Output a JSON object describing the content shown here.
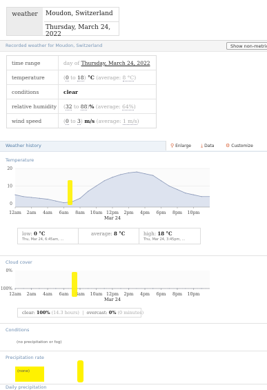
{
  "query": {
    "key": "weather",
    "location": "Moudon, Switzerland",
    "date": "Thursday, March 24, 2022"
  },
  "recorded": {
    "title": "Recorded weather for Moudon, Switzerland",
    "metric_button": "Show non-metric"
  },
  "table": {
    "rows": [
      {
        "label": "time range",
        "prefix": "day of ",
        "value": "Thursday, March 24, 2022"
      },
      {
        "label": "temperature",
        "range_open": "(",
        "low": "0",
        "to": " to ",
        "high": "18",
        "range_close": ")",
        "unit": " °C",
        "avg_open": " (average: ",
        "avg": "8 °C",
        "avg_close": ")"
      },
      {
        "label": "conditions",
        "value": "clear"
      },
      {
        "label": "relative humidity",
        "range_open": "(",
        "low": "32",
        "to": " to ",
        "high": "88",
        "range_close": ")",
        "unit": "%",
        "avg_open": " (average: ",
        "avg": "64%",
        "avg_close": ")"
      },
      {
        "label": "wind speed",
        "range_open": "(",
        "low": "0",
        "to": " to ",
        "high": "3",
        "range_close": ")",
        "unit": " m/s",
        "avg_open": " (average: ",
        "avg": "1 m/s",
        "avg_close": ")"
      }
    ]
  },
  "history": {
    "title": "Weather history",
    "tools": [
      "Enlarge",
      "Data",
      "Customize"
    ],
    "icons": [
      "magnifier-icon",
      "download-icon",
      "customize-icon"
    ]
  },
  "temperature": {
    "subtitle": "Temperature",
    "stats": {
      "low_label": "low: ",
      "low_value": "0 °C",
      "low_time": "Thu, Mar 24, 6:45am, ...",
      "avg_label": "average: ",
      "avg_value": "8 °C",
      "high_label": "high: ",
      "high_value": "18 °C",
      "high_time": "Thu, Mar 24, 3:45pm, ..."
    }
  },
  "cloud": {
    "subtitle": "Cloud cover",
    "stats": {
      "clear_label": "clear: ",
      "clear_value": "100%",
      "clear_dur": " (14.3 hours)",
      "sep": "  |  ",
      "overcast_label": "overcast: ",
      "overcast_value": "0%",
      "overcast_dur": " (0 minutes)"
    }
  },
  "conditions": {
    "subtitle": "Conditions",
    "note": "(no precipitation or fog)"
  },
  "precip_rate": {
    "subtitle": "Precipitation rate",
    "note": "(none)"
  },
  "daily_precip": {
    "subtitle": "Daily precipitation"
  },
  "chart_data": [
    {
      "type": "area",
      "title": "Temperature",
      "xlabel": "Mar 24",
      "ylabel": "",
      "x": [
        "12am",
        "1am",
        "2am",
        "3am",
        "4am",
        "5am",
        "6am",
        "7am",
        "8am",
        "9am",
        "10am",
        "11am",
        "12pm",
        "1pm",
        "2pm",
        "3pm",
        "4pm",
        "5pm",
        "6pm",
        "7pm",
        "8pm",
        "9pm",
        "10pm",
        "11pm"
      ],
      "xtick_labels": [
        "12am",
        "2am",
        "4am",
        "6am",
        "8am",
        "10am",
        "12pm",
        "2pm",
        "4pm",
        "6pm",
        "8pm",
        "10pm"
      ],
      "y": [
        5,
        4,
        3.5,
        3,
        2.5,
        1.5,
        0.5,
        1,
        3,
        7,
        10,
        13,
        15,
        16.5,
        17.5,
        18,
        17,
        16,
        13,
        10,
        8,
        6,
        5,
        4
      ],
      "yticks": [
        0,
        10,
        20
      ],
      "ylim": [
        -2,
        20
      ],
      "color": "#dde3ef",
      "line_color": "#8a98b8"
    },
    {
      "type": "area",
      "title": "Cloud cover",
      "xlabel": "Mar 24",
      "ylabel": "",
      "x": [
        "12am",
        "1am",
        "2am",
        "3am",
        "4am",
        "5am",
        "6am",
        "7am",
        "8am",
        "9am",
        "10am",
        "11am",
        "12pm",
        "1pm",
        "2pm",
        "3pm",
        "4pm",
        "5pm",
        "6pm",
        "7pm",
        "8pm",
        "9pm",
        "10pm",
        "11pm"
      ],
      "xtick_labels": [
        "12am",
        "2am",
        "4am",
        "6am",
        "8am",
        "10am",
        "12pm",
        "2pm",
        "4pm",
        "6pm",
        "8pm",
        "10pm"
      ],
      "y": [
        0,
        0,
        0,
        0,
        0,
        0,
        0,
        0,
        0,
        0,
        0,
        0,
        0,
        0,
        0,
        0,
        0,
        0,
        0,
        0,
        0,
        0,
        0,
        0
      ],
      "yticks": [
        "0%",
        "100%"
      ],
      "ylim": [
        0,
        100
      ],
      "color": "#dde3ef",
      "line_color": "#8a98b8"
    }
  ]
}
